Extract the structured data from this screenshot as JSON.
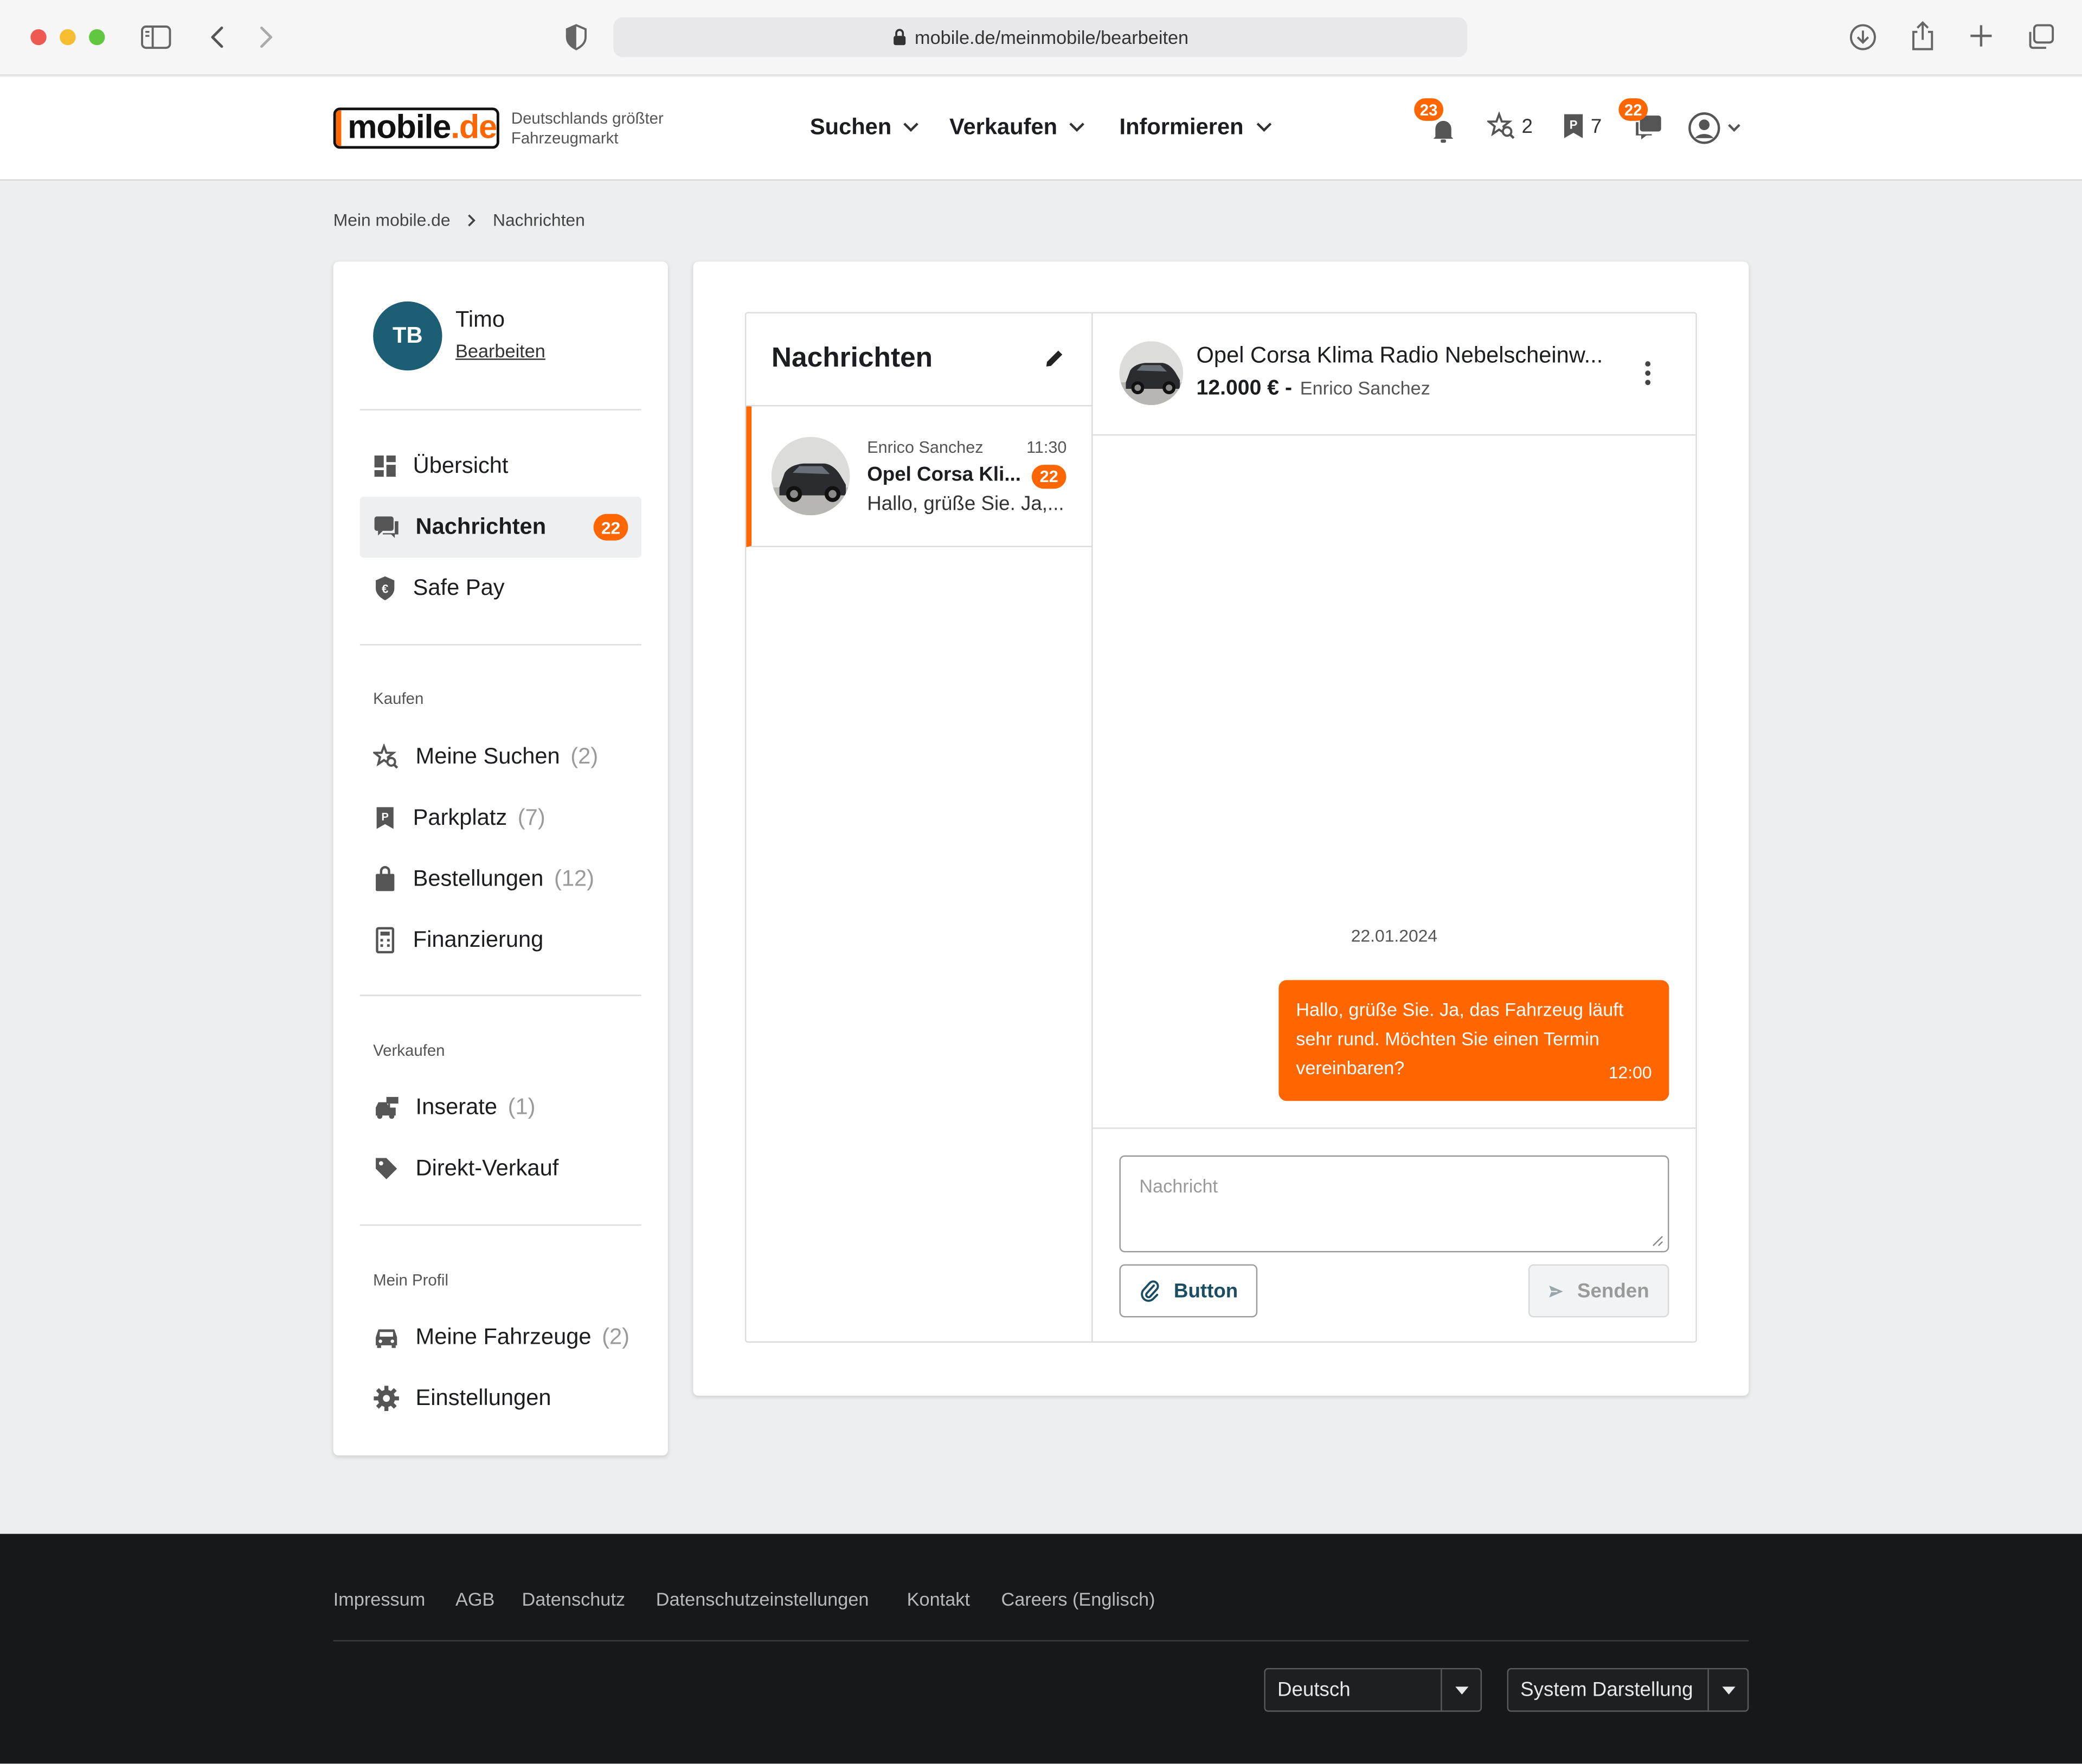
{
  "browser": {
    "url": "mobile.de/meinmobile/bearbeiten"
  },
  "header": {
    "logo_main": "mobile",
    "logo_dot": ".de",
    "tagline_line1": "Deutschlands größter",
    "tagline_line2": "Fahrzeugmarkt",
    "nav": [
      {
        "label": "Suchen"
      },
      {
        "label": "Verkaufen"
      },
      {
        "label": "Informieren"
      }
    ],
    "notifications_badge": "23",
    "saved_searches_count": "2",
    "parked_count": "7",
    "messages_badge": "22"
  },
  "breadcrumb": {
    "items": [
      "Mein mobile.de",
      "Nachrichten"
    ]
  },
  "sidebar": {
    "user": {
      "initials": "TB",
      "name": "Timo",
      "edit_label": "Bearbeiten"
    },
    "top_items": [
      {
        "label": "Übersicht",
        "icon": "dashboard-icon"
      },
      {
        "label": "Nachrichten",
        "icon": "chat-icon",
        "badge": "22"
      },
      {
        "label": "Safe Pay",
        "icon": "shield-euro-icon"
      }
    ],
    "kaufen": {
      "heading": "Kaufen",
      "items": [
        {
          "label": "Meine Suchen",
          "count": "(2)"
        },
        {
          "label": "Parkplatz",
          "count": "(7)"
        },
        {
          "label": "Bestellungen",
          "count": "(12)"
        },
        {
          "label": "Finanzierung",
          "count": ""
        }
      ]
    },
    "verkaufen": {
      "heading": "Verkaufen",
      "items": [
        {
          "label": "Inserate",
          "count": "(1)"
        },
        {
          "label": "Direkt-Verkauf",
          "count": ""
        }
      ]
    },
    "profil": {
      "heading": "Mein Profil",
      "items": [
        {
          "label": "Meine Fahrzeuge",
          "count": "(2)"
        },
        {
          "label": "Einstellungen",
          "count": ""
        }
      ]
    }
  },
  "messages": {
    "title": "Nachrichten",
    "conversations": [
      {
        "sender": "Enrico Sanchez",
        "time": "11:30",
        "subject": "Opel Corsa Kli...",
        "badge": "22",
        "preview": "Hallo, grüße Sie. Ja,..."
      }
    ]
  },
  "chat": {
    "listing_title": "Opel Corsa Klima Radio Nebelscheinw...",
    "price": "12.000 € -",
    "seller": "Enrico Sanchez",
    "date": "22.01.2024",
    "bubble": {
      "text": "Hallo, grüße Sie. Ja, das Fahrzeug läuft sehr rund. Möchten Sie einen Termin vereinbaren?",
      "time": "12:00"
    },
    "input_placeholder": "Nachricht",
    "attach_label": "Button",
    "send_label": "Senden"
  },
  "footer": {
    "links": [
      "Impressum",
      "AGB",
      "Datenschutz",
      "Datenschutzeinstellungen",
      "Kontakt",
      "Careers (Englisch)"
    ],
    "language": "Deutsch",
    "theme": "System Darstellung"
  },
  "colors": {
    "accent": "#ff6600",
    "avatar": "#1c5f75",
    "footer": "#17181b",
    "page_bg": "#edeef0"
  }
}
